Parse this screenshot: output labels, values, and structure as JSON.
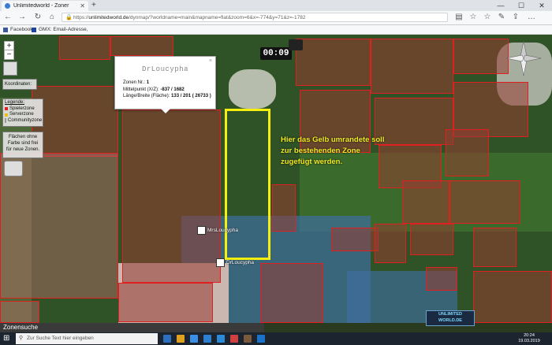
{
  "browser": {
    "tab_title": "Unlimitedworld - Zoner",
    "url_prefix": "https://",
    "url_host": "unlimitedworld.de",
    "url_rest": "/dynmap/?worldname=main&mapname=flat&zoom=6&x=-774&y=71&z=-1782",
    "bookmarks": [
      "Facebook",
      "GMX: Email-Adresse,"
    ]
  },
  "map": {
    "timer": "00:09",
    "popup": {
      "title": "DrLoucypha",
      "rows": [
        {
          "label": "Zonen Nr.:",
          "value": "1"
        },
        {
          "label": "Mittelpunkt (X/Z):",
          "value": "-837 / 1682"
        },
        {
          "label": "Länge/Breite (Fläche):",
          "value": "133 / 201 ( 26733 )"
        }
      ]
    },
    "coordinates_label": "Koordinaten:",
    "legend": {
      "title": "Legende:",
      "items": [
        {
          "label": "Spielerzone",
          "color": "#e02020"
        },
        {
          "label": "Serverzone",
          "color": "#e8c020"
        },
        {
          "label": "Communityzone",
          "color": "#ffffff"
        }
      ]
    },
    "info_text": "Flächen ohne Farbe sind frei für neue Zonen.",
    "annotation": [
      "Hier das Gelb umrandete soll",
      "zur bestehenden Zone",
      "zugefügt werden."
    ],
    "markers": [
      "MrsLoucypha",
      "DrLoucypha"
    ],
    "zone_search": "Zonensuche",
    "logo_text": [
      "UNLIMITED",
      "WORLD.DE"
    ],
    "highlight_color": "#f5ef10"
  },
  "taskbar": {
    "search_placeholder": "Zur Suche Text hier eingeben",
    "time": "20:24",
    "date": "19.03.2019"
  }
}
